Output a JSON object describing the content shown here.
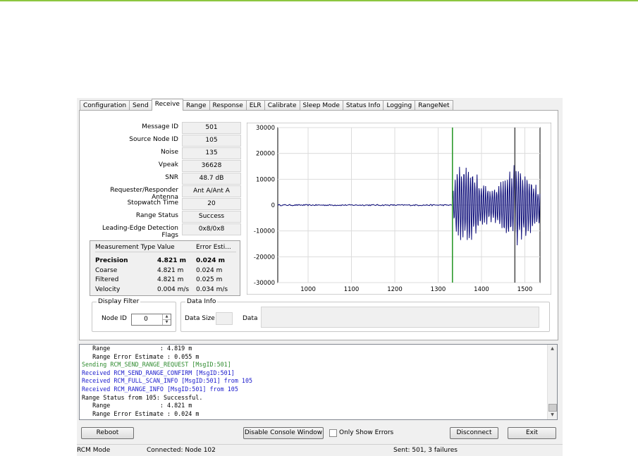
{
  "tabs": [
    "Configuration",
    "Send",
    "Receive",
    "Range",
    "Response",
    "ELR",
    "Calibrate",
    "Sleep Mode",
    "Status Info",
    "Logging",
    "RangeNet"
  ],
  "active_tab": "Receive",
  "fields": [
    {
      "label": "Message ID",
      "value": "501"
    },
    {
      "label": "Source Node ID",
      "value": "105"
    },
    {
      "label": "Noise",
      "value": "135"
    },
    {
      "label": "Vpeak",
      "value": "36628"
    },
    {
      "label": "SNR",
      "value": "48.7 dB"
    },
    {
      "label": "Requester/Responder Antenna",
      "value": "Ant A/Ant A"
    },
    {
      "label": "Stopwatch Time",
      "value": "20"
    },
    {
      "label": "Range Status",
      "value": "Success"
    },
    {
      "label": "Leading-Edge Detection Flags",
      "value": "0x8/0x8"
    }
  ],
  "measurement": {
    "headers": [
      "Measurement Type",
      "Value",
      "Error Esti..."
    ],
    "rows": [
      {
        "type": "Precision",
        "value": "4.821 m",
        "error": "0.024 m",
        "bold": true
      },
      {
        "type": "Coarse",
        "value": "4.821 m",
        "error": "0.024 m",
        "bold": false
      },
      {
        "type": "Filtered",
        "value": "4.821 m",
        "error": "0.025 m",
        "bold": false
      },
      {
        "type": "Velocity",
        "value": "0.004 m/s",
        "error": "0.034 m/s",
        "bold": false
      }
    ]
  },
  "display_filter": {
    "title": "Display Filter",
    "node_label": "Node ID",
    "node_value": "0"
  },
  "data_info": {
    "title": "Data Info",
    "size_label": "Data Size",
    "data_label": "Data"
  },
  "chart_data": {
    "type": "line",
    "series": [
      {
        "color": "#0a0a78",
        "description": "waveform: flat near 0 from ~930 to ~1333, then strong oscillation up to about ±18000"
      }
    ],
    "xlim": [
      930,
      1535
    ],
    "ylim": [
      -30000,
      30000
    ],
    "xticks": [
      1000,
      1100,
      1200,
      1300,
      1400,
      1500
    ],
    "yticks": [
      30000,
      20000,
      10000,
      0,
      -10000,
      -20000,
      -30000
    ],
    "markers": [
      {
        "x": 1333,
        "color": "#2e9a2e"
      },
      {
        "x": 1477,
        "color": "#555555"
      }
    ],
    "grid": true
  },
  "console": [
    {
      "text": "   Range              : 4.819 m",
      "color": "#000000"
    },
    {
      "text": "   Range Error Estimate : 0.055 m",
      "color": "#000000"
    },
    {
      "text": "Sending RCM_SEND_RANGE_REQUEST [MsgID:501]",
      "color": "#2e8b2e"
    },
    {
      "text": "Received RCM_SEND_RANGE_CONFIRM [MsgID:501]",
      "color": "#1a1acc"
    },
    {
      "text": "Received RCM_FULL_SCAN_INFO [MsgID:501] from 105",
      "color": "#1a1acc"
    },
    {
      "text": "Received RCM_RANGE_INFO [MsgID:501] from 105",
      "color": "#1a1acc"
    },
    {
      "text": "Range Status from 105: Successful.",
      "color": "#000000"
    },
    {
      "text": "   Range              : 4.821 m",
      "color": "#000000"
    },
    {
      "text": "   Range Error Estimate : 0.024 m",
      "color": "#000000"
    }
  ],
  "buttons": {
    "reboot": "Reboot",
    "disable_console": "Disable Console Window",
    "only_errors": "Only Show Errors",
    "disconnect": "Disconnect",
    "exit": "Exit"
  },
  "status": {
    "mode": "RCM Mode",
    "connected": "Connected: Node 102",
    "sent": "Sent: 501, 3 failures"
  }
}
